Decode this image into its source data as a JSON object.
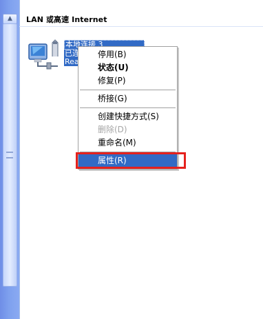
{
  "header": {
    "title": "LAN 或高速 Internet"
  },
  "connection": {
    "name": "本地连接 3",
    "status": "已连接",
    "adapter": "Realt"
  },
  "context_menu": {
    "items": [
      {
        "label": "停用(B)"
      },
      {
        "label": "状态(U)"
      },
      {
        "label": "修复(P)"
      },
      {
        "label": "桥接(G)"
      },
      {
        "label": "创建快捷方式(S)"
      },
      {
        "label": "删除(D)"
      },
      {
        "label": "重命名(M)"
      },
      {
        "label": "属性(R)"
      }
    ]
  },
  "colors": {
    "selection": "#316ac5",
    "highlight_box": "#e5211d",
    "sidebar": "#7ea0ee"
  }
}
